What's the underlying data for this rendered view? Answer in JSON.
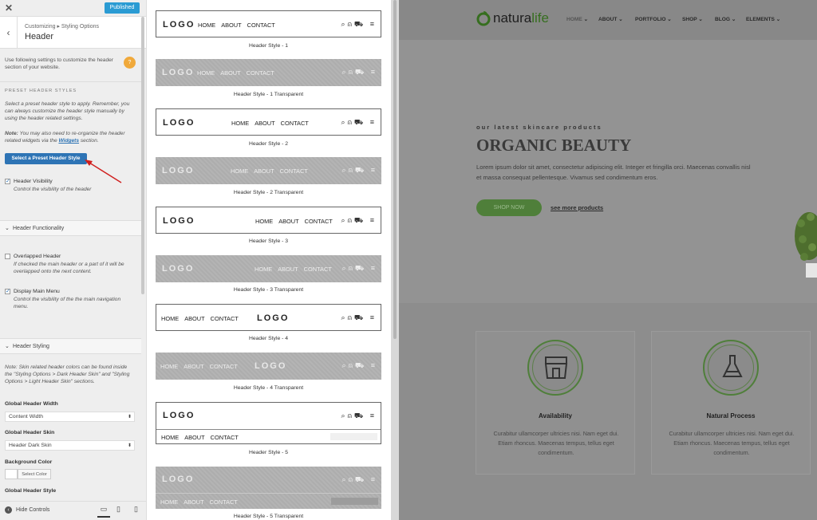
{
  "customizer": {
    "publish_label": "Published",
    "breadcrumb": "Customizing ▸ Styling Options",
    "section_title": "Header",
    "intro": "Use following settings to customize the header section of your website.",
    "help_badge": "?",
    "preset_section": "PRESET HEADER STYLES",
    "preset_desc": "Select a preset header style to apply. Remember, you can always customize the header style manually by using the header related settings.",
    "note_prefix": "Note:",
    "note_text": " You may also need to re-organize the header related widgets via the ",
    "note_link": "Widgets",
    "note_end": " section.",
    "select_preset_button": "Select a Preset Header Style",
    "header_visibility": {
      "label": "Header Visibility",
      "desc": "Control the visibility of the header",
      "checked": true
    },
    "functionality_group": "Header Functionality",
    "overlapped": {
      "label": "Overlapped Header",
      "desc": "If checked the main header or a part of it will be overlapped onto the next content.",
      "checked": false
    },
    "main_menu": {
      "label": "Display Main Menu",
      "desc": "Control the visibility of the the main navigation menu.",
      "checked": true
    },
    "styling_group": "Header Styling",
    "styling_note": "Note: Skin related header colors can be found inside the \"Styling Options > Dark Header Skin\" and \"Styling Options > Light Header Skin\" sections.",
    "width_label": "Global Header Width",
    "width_value": "Content Width",
    "skin_label": "Global Header Skin",
    "skin_value": "Header Dark Skin",
    "bg_label": "Background Color",
    "bg_button": "Select Color",
    "style_label": "Global Header Style",
    "hide_controls": "Hide Controls"
  },
  "gallery": {
    "logo": "LOGO",
    "nav": [
      "HOME",
      "ABOUT",
      "CONTACT"
    ],
    "captions": [
      "Header Style - 1",
      "Header Style - 1 Transparent",
      "Header Style - 2",
      "Header Style - 2 Transparent",
      "Header Style - 3",
      "Header Style - 3 Transparent",
      "Header Style - 4",
      "Header Style - 4 Transparent",
      "Header Style - 5",
      "Header Style - 5 Transparent"
    ]
  },
  "site": {
    "brand_a": "natura",
    "brand_b": "life",
    "menu": [
      "HOME",
      "ABOUT",
      "PORTFOLIO",
      "SHOP",
      "BLOG",
      "ELEMENTS"
    ],
    "kicker": "our latest skincare products",
    "headline": "ORGANIC BEAUTY",
    "lead": "Lorem ipsum dolor sit amet, consectetur adipiscing elit. Integer et fringilla orci. Maecenas convallis nisl et massa consequat pellentesque. Vivamus sed condimentum eros.",
    "shop_button": "SHOP NOW",
    "more_link": "see more products",
    "cards": [
      {
        "title": "Availability",
        "text": "Curabitur ullamcorper ultricies nisi. Nam eget dui. Etiam rhoncus. Maecenas tempus, tellus eget condimentum."
      },
      {
        "title": "Natural Process",
        "text": "Curabitur ullamcorper ultricies nisi. Nam eget dui. Etiam rhoncus. Maecenas tempus, tellus eget condimentum."
      }
    ],
    "colors": {
      "accent": "#4a7a32",
      "overlay": "#8f8f8f"
    }
  }
}
